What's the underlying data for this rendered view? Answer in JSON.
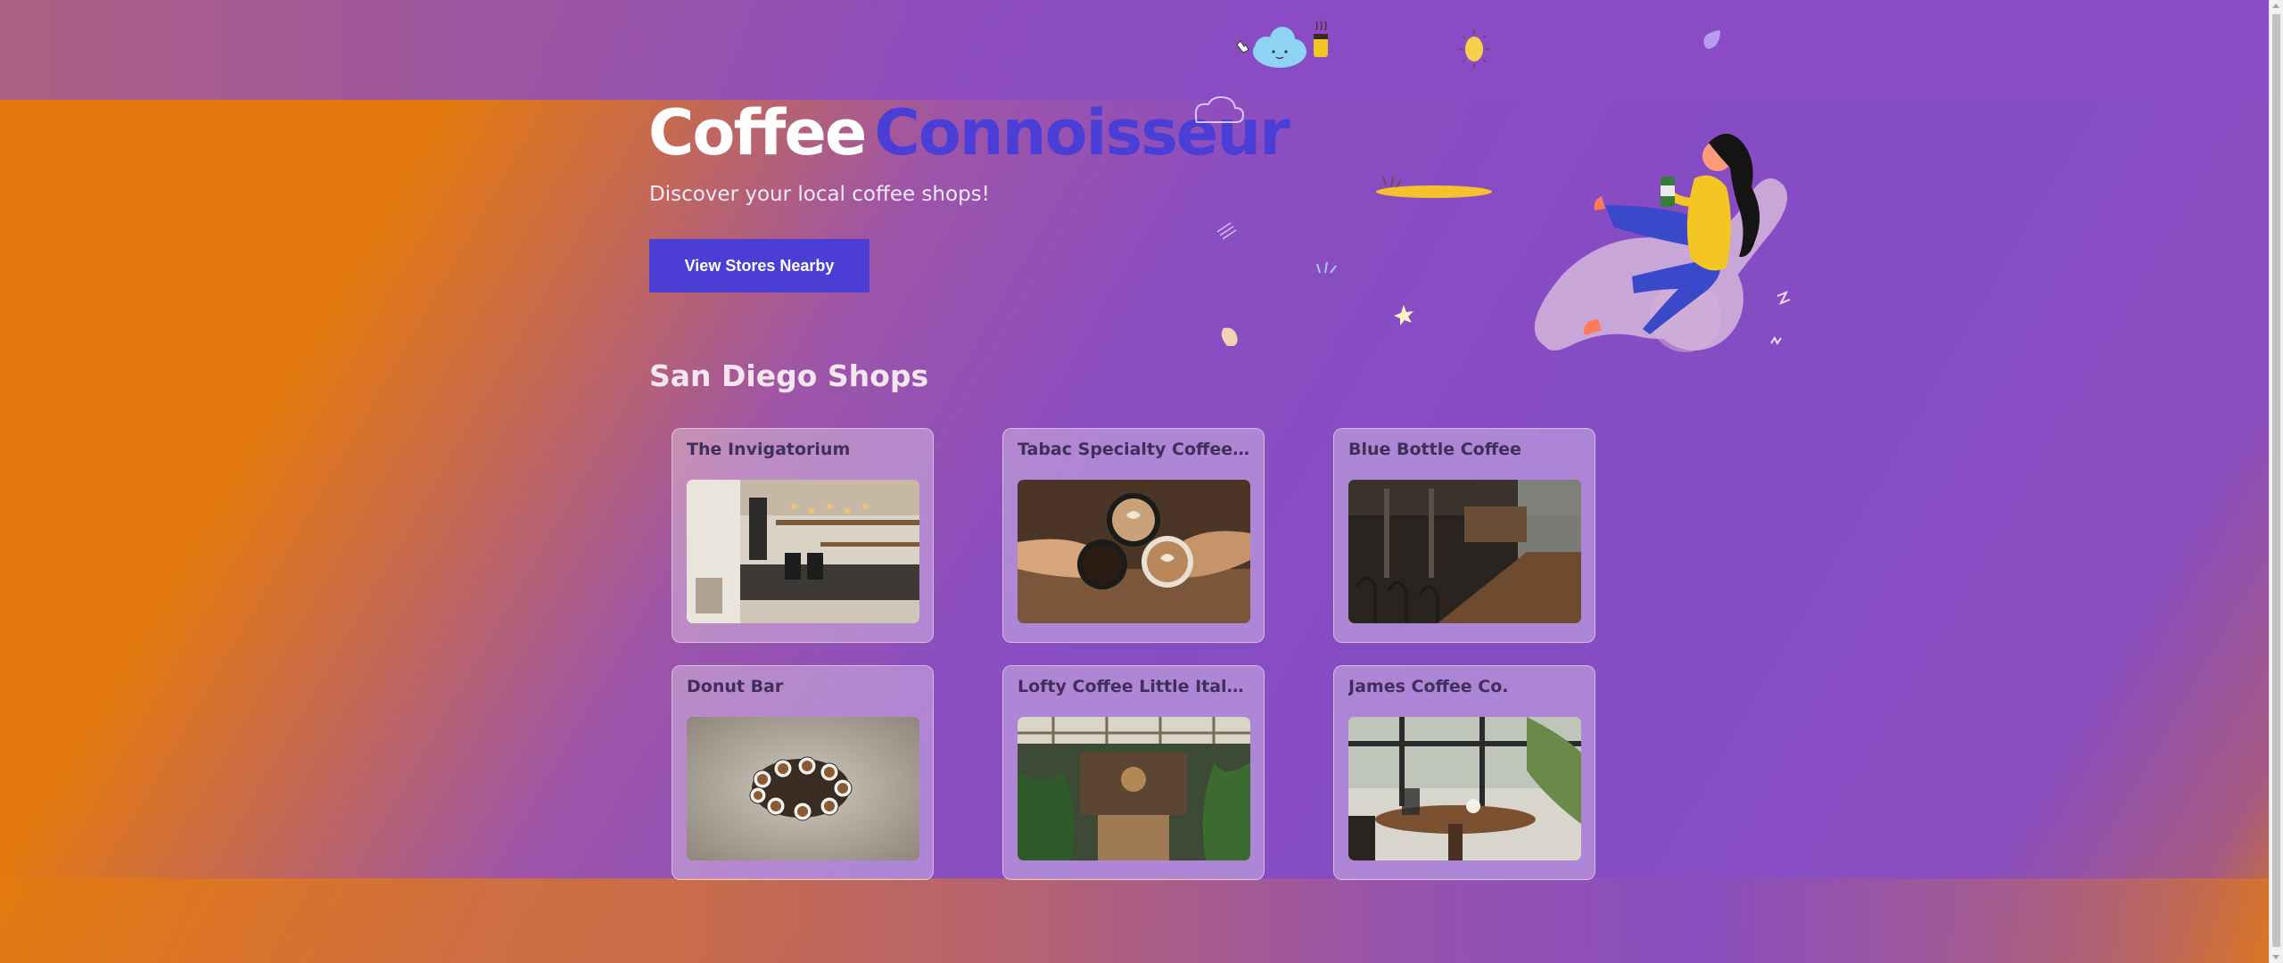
{
  "hero": {
    "title_part1": "Coffee",
    "title_part2": "Connoisseur",
    "subtitle": "Discover your local coffee shops!",
    "cta_label": "View Stores Nearby"
  },
  "section": {
    "title": "San Diego Shops"
  },
  "shops": [
    {
      "name": "The Invigatorium"
    },
    {
      "name": "Tabac Specialty Coffee & Cafe"
    },
    {
      "name": "Blue Bottle Coffee"
    },
    {
      "name": "Donut Bar"
    },
    {
      "name": "Lofty Coffee Little Italy Cafe"
    },
    {
      "name": "James Coffee Co."
    }
  ],
  "colors": {
    "accent": "#4a3ed4",
    "bg_purple": "#894cc6",
    "bg_orange": "#e3790f"
  },
  "icons": [
    "cloud-icon",
    "coffee-cup-icon",
    "sun-icon",
    "sparkle-icon",
    "leaf-icon"
  ]
}
